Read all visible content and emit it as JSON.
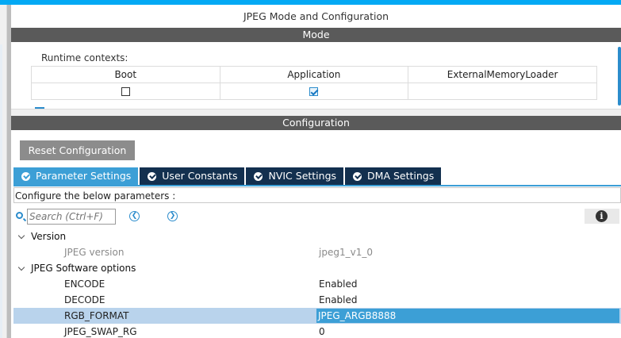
{
  "panel": {
    "title": "JPEG Mode and Configuration"
  },
  "mode": {
    "section_title": "Mode",
    "runtime_label": "Runtime contexts:",
    "contexts": [
      {
        "name": "Boot",
        "checked": false
      },
      {
        "name": "Application",
        "checked": true
      },
      {
        "name": "ExternalMemoryLoader",
        "checked": null
      }
    ]
  },
  "configuration": {
    "section_title": "Configuration",
    "reset_label": "Reset Configuration",
    "tabs": [
      {
        "label": "Parameter Settings",
        "active": true
      },
      {
        "label": "User Constants",
        "active": false
      },
      {
        "label": "NVIC Settings",
        "active": false
      },
      {
        "label": "DMA Settings",
        "active": false
      }
    ],
    "hint": "Configure the below parameters :",
    "search": {
      "placeholder": "Search (Ctrl+F)"
    },
    "info_icon": "info-icon",
    "groups": [
      {
        "label": "Version",
        "params": [
          {
            "name": "JPEG version",
            "value": "jpeg1_v1_0",
            "muted": true
          }
        ]
      },
      {
        "label": "JPEG Software options",
        "params": [
          {
            "name": "ENCODE",
            "value": "Enabled"
          },
          {
            "name": "DECODE",
            "value": "Enabled"
          },
          {
            "name": "RGB_FORMAT",
            "value": "JPEG_ARGB8888",
            "selected": true
          },
          {
            "name": "JPEG_SWAP_RG",
            "value": "0"
          }
        ]
      }
    ]
  },
  "colors": {
    "accent": "#03a9f4",
    "tab_active": "#3c9fd6",
    "tab_inactive": "#13304f",
    "section_bar": "#5a5a5a",
    "selected_row": "#b9d3ec"
  }
}
